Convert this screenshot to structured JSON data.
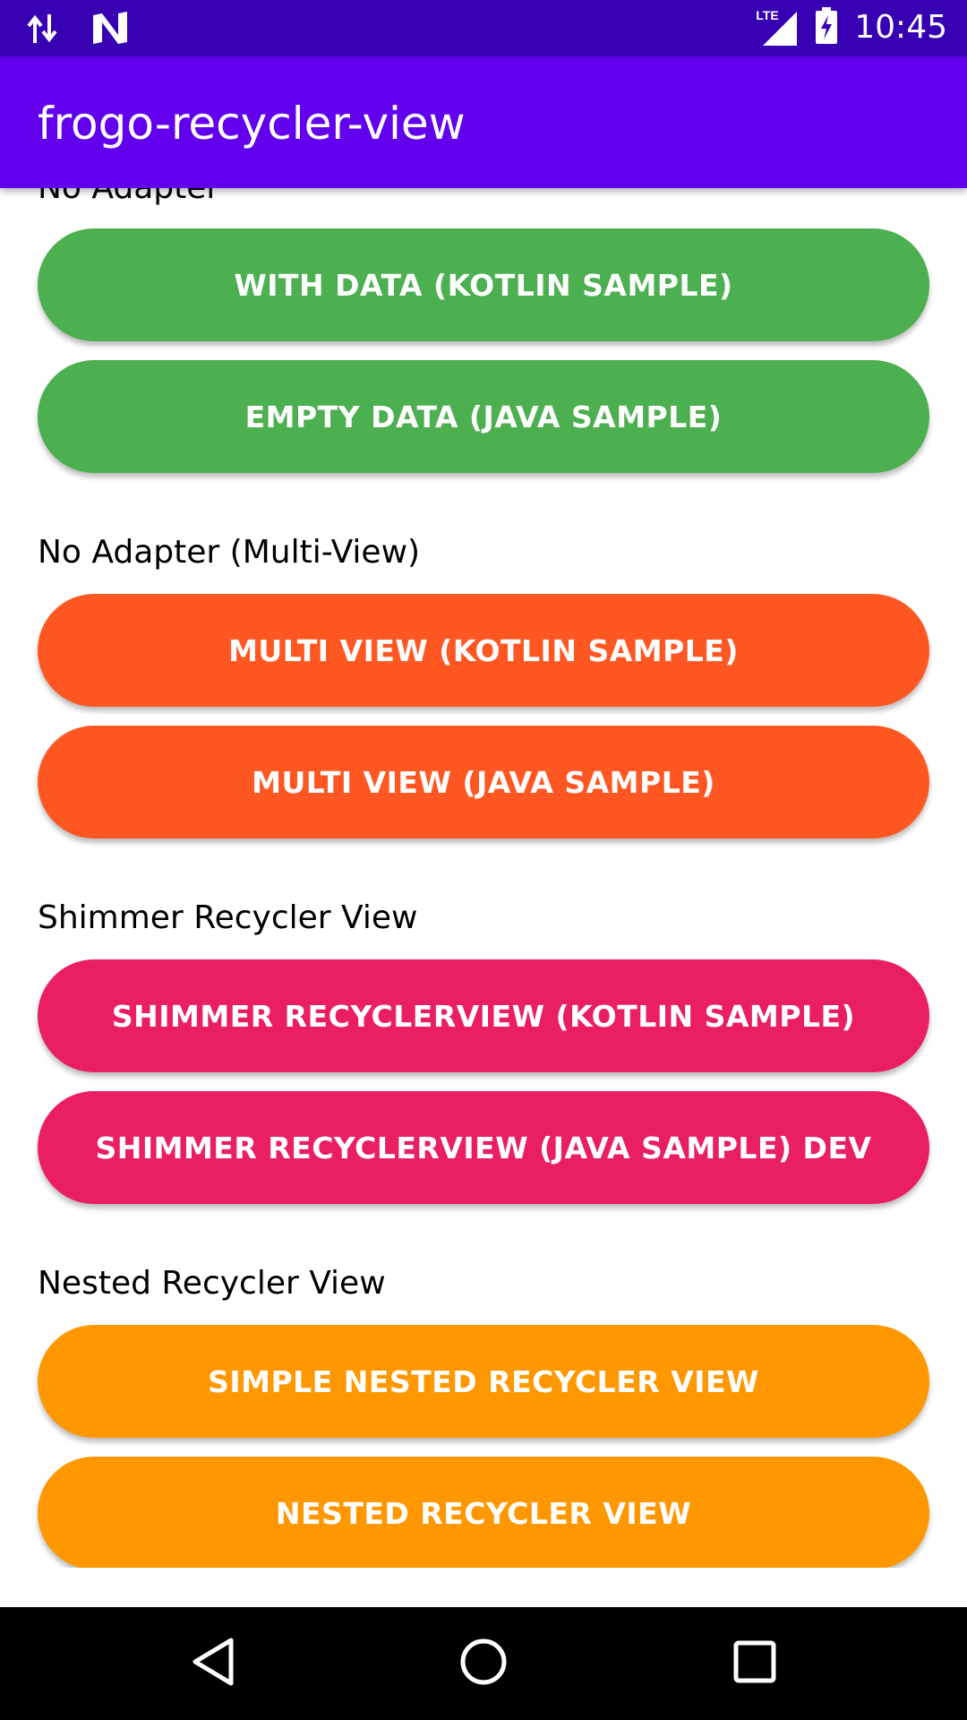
{
  "status_bar": {
    "time": "10:45",
    "network_label": "LTE",
    "icons": [
      "data-transfer-icon",
      "n-logo-icon",
      "lte-signal-icon",
      "battery-charging-icon"
    ]
  },
  "app_bar": {
    "title": "frogo-recycler-view",
    "color": "#6200EE"
  },
  "sections": [
    {
      "label": "No Adapter",
      "color": "#4CAF50",
      "buttons": [
        "WITH DATA (KOTLIN SAMPLE)",
        "EMPTY DATA (JAVA SAMPLE)"
      ]
    },
    {
      "label": "No Adapter (Multi-View)",
      "color": "#FF5722",
      "buttons": [
        "MULTI VIEW (KOTLIN SAMPLE)",
        "MULTI VIEW (JAVA SAMPLE)"
      ]
    },
    {
      "label": "Shimmer Recycler View",
      "color": "#E91E63",
      "buttons": [
        "SHIMMER RECYCLERVIEW (KOTLIN SAMPLE)",
        "SHIMMER RECYCLERVIEW (JAVA SAMPLE) DEV"
      ]
    },
    {
      "label": "Nested Recycler View",
      "color": "#FF9800",
      "buttons": [
        "SIMPLE NESTED RECYCLER VIEW",
        "NESTED RECYCLER VIEW"
      ]
    }
  ],
  "nav_bar": {
    "icons": [
      "back-icon",
      "home-icon",
      "recents-icon"
    ]
  }
}
